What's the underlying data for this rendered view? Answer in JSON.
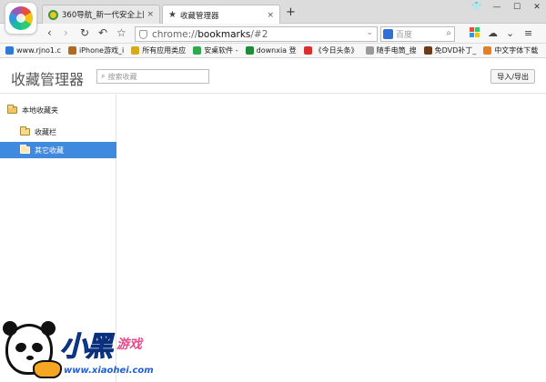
{
  "browser": {
    "tabs": [
      {
        "title": "360导航_新一代安全上网导航",
        "close": "×",
        "active": false
      },
      {
        "title": "收藏管理器",
        "close": "×",
        "active": true
      }
    ],
    "new_tab": "+",
    "window_controls": [
      "👕",
      "—",
      "☐",
      "✕"
    ],
    "address": {
      "scheme": "chrome://",
      "host": "bookmarks",
      "path": "/#2"
    },
    "search_engine": "百度",
    "bookmarks": [
      {
        "label": "www.rjno1.c",
        "icon_color": "#2d7bd6"
      },
      {
        "label": "iPhone游戏_i",
        "icon_color": "#b46a1e"
      },
      {
        "label": "所有应用类应",
        "icon_color": "#d4a91e"
      },
      {
        "label": "安桌软件 -",
        "icon_color": "#2fa84f"
      },
      {
        "label": "downxia 登",
        "icon_color": "#1f8a3a"
      },
      {
        "label": "《今日头条》",
        "icon_color": "#d9302c"
      },
      {
        "label": "随手电筒_搜",
        "icon_color": "#9a9a9a"
      },
      {
        "label": "免DVD补丁_",
        "icon_color": "#6a3a1a"
      },
      {
        "label": "中文字体下载",
        "icon_color": "#e67e22"
      }
    ]
  },
  "page": {
    "title": "收藏管理器",
    "search_placeholder": "搜索收藏",
    "import_export_label": "导入/导出",
    "tree": {
      "root": "本地收藏夹",
      "children": [
        {
          "label": "收藏栏",
          "selected": false
        },
        {
          "label": "其它收藏",
          "selected": true
        }
      ]
    },
    "selection_color": "#3f89de"
  },
  "watermark": {
    "logo": "小黑",
    "game": "游戏",
    "url": "www.xiaohei.com"
  }
}
